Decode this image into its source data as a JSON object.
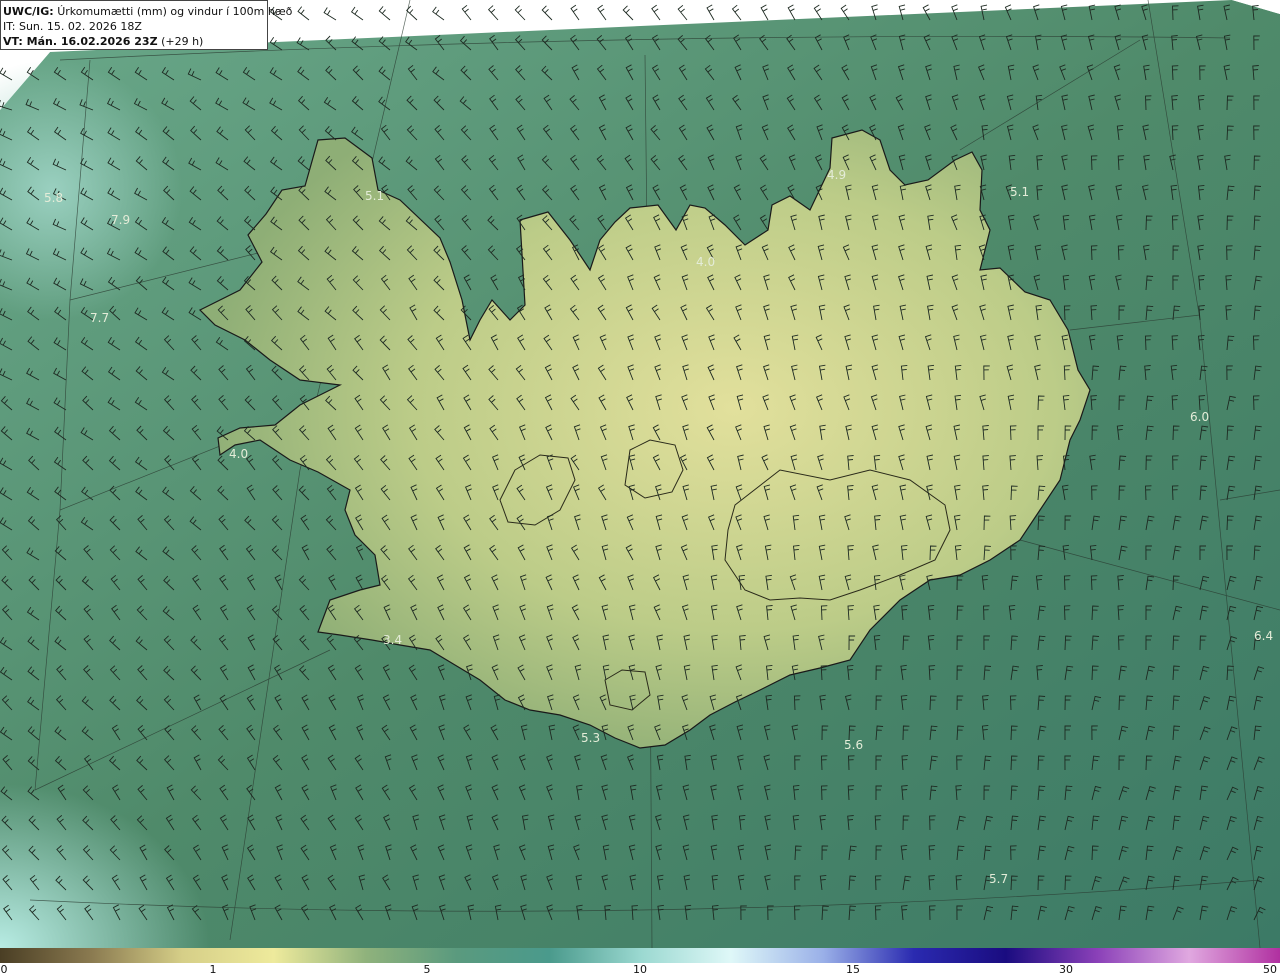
{
  "header": {
    "model_prefix": "UWC/IG:",
    "title": "Úrkomumætti (mm) og vindur í 100m hæð",
    "init_line": "IT: Sun. 15. 02. 2026 18Z",
    "valid_prefix": "VT: Mán. 16.02.2026 23Z",
    "valid_suffix": "(+29 h)"
  },
  "map_labels": [
    {
      "text": "5.8",
      "name": "value-label-west-sea"
    },
    {
      "text": "7.9",
      "name": "value-label-west-sea-2"
    },
    {
      "text": "5.1",
      "name": "value-label-westfjords"
    },
    {
      "text": "7.7",
      "name": "value-label-west-sea-3"
    },
    {
      "text": "4.0",
      "name": "value-label-snaefellsnes"
    },
    {
      "text": "4.9",
      "name": "value-label-north-sea"
    },
    {
      "text": "5.1",
      "name": "value-label-northeast-sea"
    },
    {
      "text": "4.0",
      "name": "value-label-north-interior"
    },
    {
      "text": "6.0",
      "name": "value-label-east-sea"
    },
    {
      "text": "6.4",
      "name": "value-label-east-sea-2"
    },
    {
      "text": "3.4",
      "name": "value-label-reykjanes"
    },
    {
      "text": "5.3",
      "name": "value-label-south-coast"
    },
    {
      "text": "5.6",
      "name": "value-label-southeast-sea"
    },
    {
      "text": "5.7",
      "name": "value-label-south-sea"
    }
  ],
  "colorbar": {
    "ticks": [
      "0",
      "1",
      "5",
      "10",
      "15",
      "30",
      "50"
    ],
    "colors": [
      "#4a3e24",
      "#8a7a50",
      "#d6cf88",
      "#eeea9c",
      "#8fb27c",
      "#5a9a7e",
      "#4a9a8c",
      "#9ad8d0",
      "#dff8f8",
      "#9ab0e8",
      "#2a2ab0",
      "#1a0c80",
      "#8a40b8",
      "#e0a8e0",
      "#b030a0"
    ]
  },
  "map_colors": {
    "sea": "#4e8a6c",
    "sea_light": "#8ac8b8",
    "land": "#b6c888",
    "land_light": "#dcdc98",
    "coast": "#1a1a1a"
  }
}
